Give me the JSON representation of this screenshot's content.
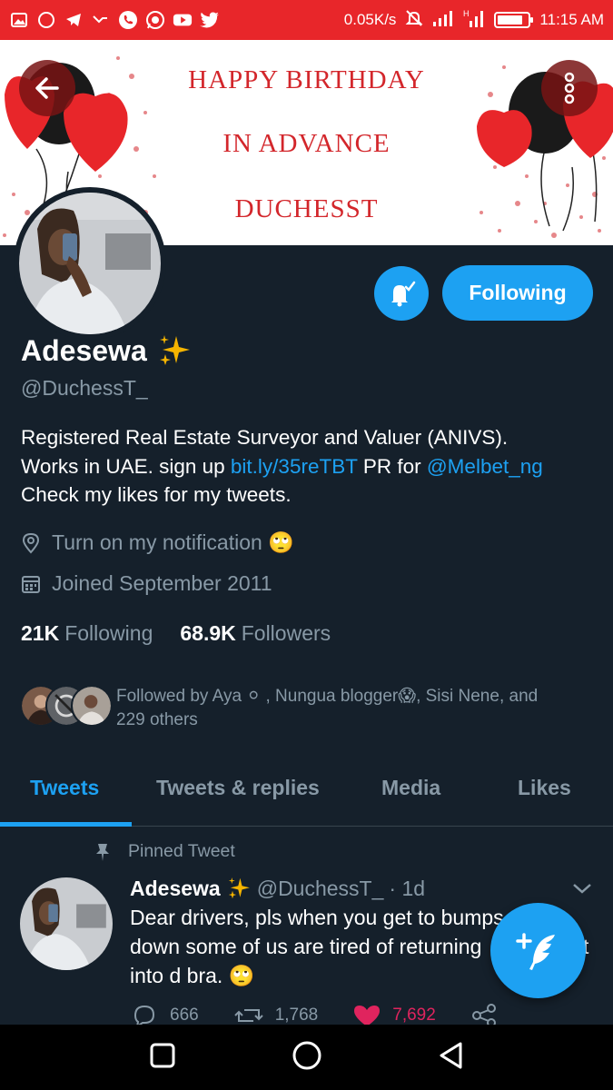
{
  "status_bar": {
    "network_speed": "0.05K/s",
    "time": "11:15 AM",
    "battery_level": 0.85,
    "icons": [
      "gallery-icon",
      "chat-icon",
      "telegram-icon",
      "missed-call-icon",
      "phone-icon",
      "whatsapp-icon",
      "youtube-icon",
      "twitter-icon",
      "mute-icon",
      "signal-icon",
      "signal-h-icon"
    ]
  },
  "banner": {
    "line1": "HAPPY BIRTHDAY",
    "line2": "IN ADVANCE",
    "line3": "DUCHESST"
  },
  "profile": {
    "name": "Adesewa",
    "name_emoji": "✨",
    "handle": "@DuchessT_",
    "follow_button": "Following",
    "bio_line1": "Registered Real Estate Surveyor and Valuer (ANIVS).",
    "bio_line2_prefix": "Works in UAE. sign up ",
    "bio_link": "bit.ly/35reTBT",
    "bio_line2_mid": " PR for ",
    "bio_mention": "@Melbet_ng",
    "bio_line3": "Check my likes for my tweets.",
    "location": "Turn on my notification 🙄",
    "joined": "Joined September 2011",
    "following_count": "21K",
    "following_label": "Following",
    "followers_count": "68.9K",
    "followers_label": "Followers",
    "followed_by_line1": "Followed by Aya ⚪ , Nungua blogger😱, Sisi Nene, and",
    "followed_by_line2": "229 others"
  },
  "tabs": [
    {
      "label": "Tweets",
      "active": true
    },
    {
      "label": "Tweets & replies",
      "active": false
    },
    {
      "label": "Media",
      "active": false
    },
    {
      "label": "Likes",
      "active": false
    }
  ],
  "tweet": {
    "pinned_label": "Pinned Tweet",
    "author_name": "Adesewa",
    "author_emoji": "✨",
    "author_handle": "@DuchessT_",
    "time": "· 1d",
    "text_line1": "Dear drivers, pls when you get to bumps",
    "text_line2": "down some of us are tired of returning",
    "text_line2_end": "t",
    "text_line3": "into d bra. 🙄",
    "replies": "666",
    "retweets": "1,768",
    "likes": "7,692"
  },
  "colors": {
    "accent": "#1da1f2",
    "background": "#15202b",
    "status_bar": "#e8262a",
    "banner_text": "#d3262b",
    "secondary_text": "#8899a6",
    "like": "#e0245e"
  }
}
